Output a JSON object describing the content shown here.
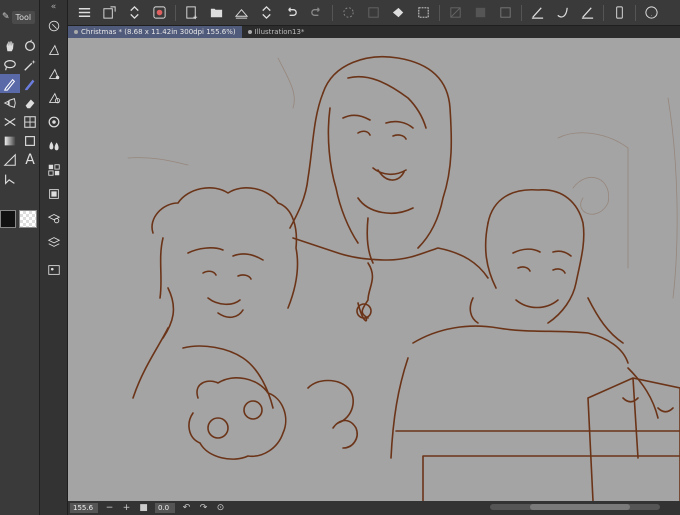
{
  "tool_panel": {
    "header_label": "Tool",
    "tools": [
      {
        "name": "hand-icon"
      },
      {
        "name": "rotate-icon"
      },
      {
        "name": "lasso-icon"
      },
      {
        "name": "magic-wand-icon"
      },
      {
        "name": "pen-icon",
        "active": true
      },
      {
        "name": "pencil-icon",
        "active": true
      },
      {
        "name": "airbrush-icon"
      },
      {
        "name": "eraser-icon"
      },
      {
        "name": "balloon-icon"
      },
      {
        "name": "frame-icon"
      },
      {
        "name": "gradient-icon"
      },
      {
        "name": "shape-icon"
      },
      {
        "name": "ruler-icon"
      },
      {
        "name": "text-icon"
      },
      {
        "name": "correct-line-icon"
      }
    ]
  },
  "command_panel": {
    "buttons": [
      "navigator-icon",
      "sub-tool-icon",
      "tool-property-icon",
      "brush-size-icon",
      "color-wheel-icon",
      "color-set-icon",
      "intermediate-color-icon",
      "layer-property-icon",
      "layer-icon",
      "material-icon"
    ]
  },
  "toolbar": {
    "buttons": [
      "menu-icon",
      "new-icon",
      "open-icon",
      "clip-studio-icon",
      "new-canvas-icon",
      "folder-open-icon",
      "save-icon",
      "save-arrows-icon",
      "undo-icon",
      "redo-icon",
      "loading-icon",
      "layer-clear-icon",
      "fill-icon",
      "transform-icon",
      "hide-selection-icon",
      "clear-outside-icon",
      "fill-selection-icon",
      "vector-icon",
      "correct-icon",
      "brush-icon",
      "adjust-icon",
      "smartphone-icon",
      "help-icon"
    ]
  },
  "document_tabs": [
    {
      "label": "Christmas * (8.68 x 11.42in 300dpi 155.6%)",
      "active": true
    },
    {
      "label": "Illustration13*",
      "active": false
    }
  ],
  "status_bar": {
    "zoom": "155.6",
    "rotation": "0.0"
  },
  "colors": {
    "canvas_bg": "#a4a4a4",
    "line_color": "#6b3418",
    "accent": "#5a6aa8"
  }
}
